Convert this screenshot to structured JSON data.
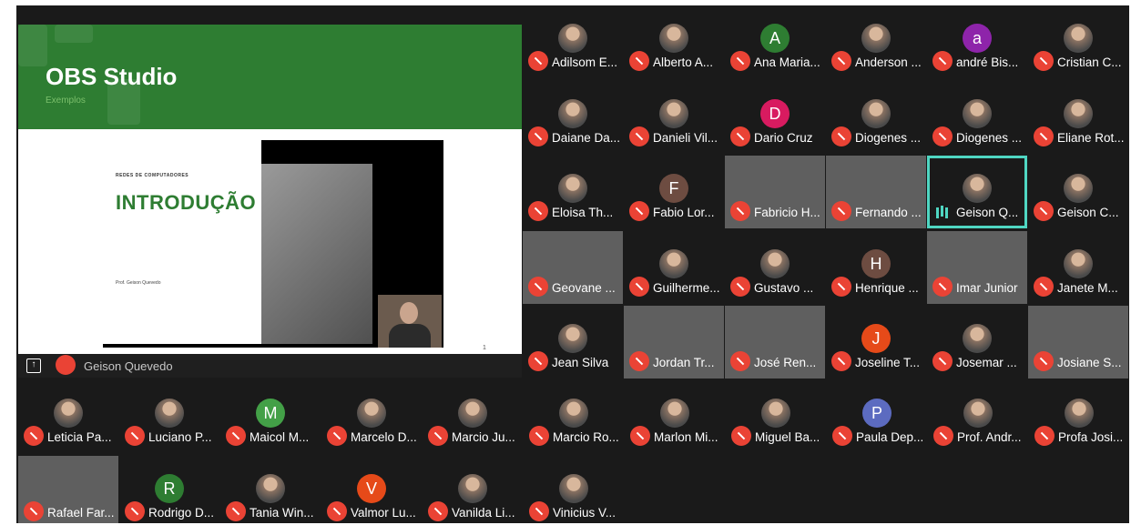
{
  "presentation": {
    "slide_title": "OBS Studio",
    "slide_subtitle": "Exemplos",
    "inner_label": "REDES DE COMPUTADORES",
    "inner_title": "INTRODUÇÃO",
    "inner_author": "Prof. Geison Quevedo",
    "page_number": "1",
    "presenter_name": "Geison Quevedo",
    "presenter_icon": "present-to-all-icon",
    "presenter_mic_icon": "mic-off-icon"
  },
  "participants": [
    {
      "name": "Adilsom E...",
      "avatar": "photo"
    },
    {
      "name": "Alberto A...",
      "avatar": "photo"
    },
    {
      "name": "Ana Maria...",
      "avatar": "letter",
      "initial": "A",
      "color": "#2e7d32"
    },
    {
      "name": "Anderson ...",
      "avatar": "photo"
    },
    {
      "name": "andré Bis...",
      "avatar": "letter",
      "initial": "a",
      "color": "#8e24aa"
    },
    {
      "name": "Cristian C...",
      "avatar": "photo"
    },
    {
      "name": "Daiane Da...",
      "avatar": "photo"
    },
    {
      "name": "Danieli Vil...",
      "avatar": "photo"
    },
    {
      "name": "Dario Cruz",
      "avatar": "letter",
      "initial": "D",
      "color": "#d81b60"
    },
    {
      "name": "Diogenes ...",
      "avatar": "photo"
    },
    {
      "name": "Diogenes ...",
      "avatar": "photo"
    },
    {
      "name": "Eliane Rot...",
      "avatar": "photo"
    },
    {
      "name": "Eloisa Th...",
      "avatar": "photo"
    },
    {
      "name": "Fabio Lor...",
      "avatar": "letter",
      "initial": "F",
      "color": "#6d4c41"
    },
    {
      "name": "Fabricio H...",
      "avatar": "video"
    },
    {
      "name": "Fernando ...",
      "avatar": "video"
    },
    {
      "name": "Geison Q...",
      "avatar": "photo",
      "speaking": true
    },
    {
      "name": "Geison C...",
      "avatar": "photo"
    },
    {
      "name": "Geovane ...",
      "avatar": "video"
    },
    {
      "name": "Guilherme...",
      "avatar": "photo"
    },
    {
      "name": "Gustavo ...",
      "avatar": "photo"
    },
    {
      "name": "Henrique ...",
      "avatar": "letter",
      "initial": "H",
      "color": "#6d4c41"
    },
    {
      "name": "Imar Junior",
      "avatar": "video"
    },
    {
      "name": "Janete M...",
      "avatar": "photo"
    },
    {
      "name": "Jean Silva",
      "avatar": "photo"
    },
    {
      "name": "Jordan Tr...",
      "avatar": "video"
    },
    {
      "name": "José Ren...",
      "avatar": "video"
    },
    {
      "name": "Joseline T...",
      "avatar": "letter",
      "initial": "J",
      "color": "#e64a19"
    },
    {
      "name": "Josemar ...",
      "avatar": "photo"
    },
    {
      "name": "Josiane S...",
      "avatar": "video"
    },
    {
      "name": "Leticia Pa...",
      "avatar": "photo"
    },
    {
      "name": "Luciano P...",
      "avatar": "photo"
    },
    {
      "name": "Maicol M...",
      "avatar": "letter",
      "initial": "M",
      "color": "#43a047"
    },
    {
      "name": "Marcelo D...",
      "avatar": "photo"
    },
    {
      "name": "Marcio Ju...",
      "avatar": "photo"
    },
    {
      "name": "Marcio Ro...",
      "avatar": "photo"
    },
    {
      "name": "Marlon Mi...",
      "avatar": "photo"
    },
    {
      "name": "Miguel Ba...",
      "avatar": "photo"
    },
    {
      "name": "Paula Dep...",
      "avatar": "letter",
      "initial": "P",
      "color": "#5c6bc0"
    },
    {
      "name": "Prof. Andr...",
      "avatar": "photo"
    },
    {
      "name": "Profa Josi...",
      "avatar": "photo"
    },
    {
      "name": "Rafael Far...",
      "avatar": "video"
    },
    {
      "name": "Rodrigo D...",
      "avatar": "letter",
      "initial": "R",
      "color": "#2e7d32"
    },
    {
      "name": "Tania Win...",
      "avatar": "photo"
    },
    {
      "name": "Valmor Lu...",
      "avatar": "letter",
      "initial": "V",
      "color": "#e64a19"
    },
    {
      "name": "Vanilda Li...",
      "avatar": "photo"
    },
    {
      "name": "Vinicius V...",
      "avatar": "photo"
    }
  ],
  "colors": {
    "muted": "#ea4335",
    "speaking_outline": "#4fd6c2",
    "slide_green": "#2e7d32"
  }
}
